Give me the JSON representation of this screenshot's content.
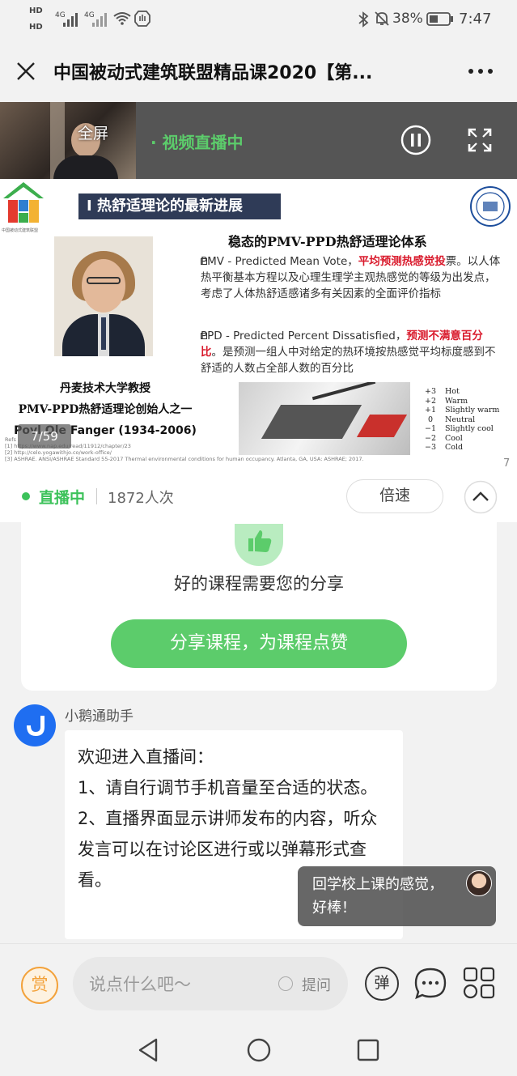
{
  "status_bar": {
    "hd1": "HD",
    "hd2": "HD",
    "sig1": "4G",
    "sig2": "4G",
    "battery": "38%",
    "time": "7:47"
  },
  "title_bar": {
    "title": "中国被动式建筑联盟精品课2020【第..."
  },
  "video": {
    "fullscreen_label": "全屏",
    "live_label": "· 视频直播中"
  },
  "slide": {
    "heading": "I 热舒适理论的最新进展",
    "logo_caption": "中国被动式建筑联盟",
    "subtitle": "稳态的PMV-PPD热舒适理论体系",
    "pmv_prefix": "PMV - Predicted Mean Vote，",
    "pmv_highlight": "平均预测热感觉投",
    "pmv_rest": "票。以人体热平衡基本方程以及心理生理学主观热感觉的等级为出发点，考虑了人体热舒适感诸多有关因素的全面评价指标",
    "ppd_prefix": "PPD - Predicted Percent Dissatisfied，",
    "ppd_highlight": "预测不满意百分比",
    "ppd_rest": "。是预测一组人中对给定的热环境按热感觉平均标度感到不舒适的人数占全部人数的百分比",
    "person_line1": "丹麦技术大学教授",
    "person_line2": "PMV-PPD热舒适理论创始人之一",
    "person_line3": "Povl Ole Fanger (1934-2006)",
    "refs_label": "Refs",
    "ref1": "[1] https://www.nap.edu/read/11912/chapter/23",
    "ref2": "[2] http://celo.yogawithjo.co/work-office/",
    "ref3": "[3] ASHRAE. ANSI/ASHRAE Standard 55-2017 Thermal environmental conditions for human occupancy. Atlanta, GA, USA: ASHRAE; 2017.",
    "page_badge": "7/59",
    "page_number": "7",
    "scale": [
      {
        "value": "+3",
        "label": "Hot"
      },
      {
        "value": "+2",
        "label": "Warm"
      },
      {
        "value": "+1",
        "label": "Slightly warm"
      },
      {
        "value": "0",
        "label": "Neutral"
      },
      {
        "value": "−1",
        "label": "Slightly cool"
      },
      {
        "value": "−2",
        "label": "Cool"
      },
      {
        "value": "−3",
        "label": "Cold"
      }
    ]
  },
  "live_bar": {
    "status": "直播中",
    "count": "1872人次",
    "speed_button": "倍速"
  },
  "share_card": {
    "message": "好的课程需要您的分享",
    "button": "分享课程，为课程点赞"
  },
  "chat": {
    "sender": "小鹅通助手",
    "msg_line1": "欢迎进入直播间：",
    "msg_line2": "1、请自行调节手机音量至合适的状态。",
    "msg_line3": "2、直播界面显示讲师发布的内容，听众发言可以在讨论区进行或以弹幕形式查看。",
    "danmaku": "回学校上课的感觉，好棒！"
  },
  "input_bar": {
    "reward_icon_text": "赏",
    "placeholder": "说点什么吧～",
    "question_label": "提问",
    "danmaku_button": "弹"
  },
  "colors": {
    "accent_green": "#5ccc6b",
    "live_dot": "#3cc25a",
    "highlight_red": "#d9192b",
    "slide_heading_bg": "#2f3b57",
    "reward_orange": "#f3a23b"
  }
}
